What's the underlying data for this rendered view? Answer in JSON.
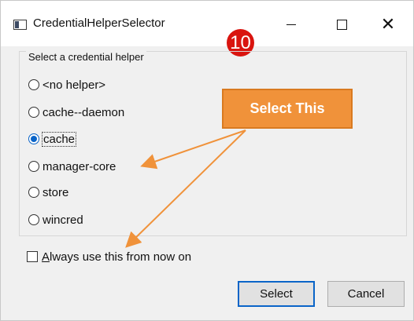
{
  "window": {
    "title": "CredentialHelperSelector",
    "controls": {
      "minimize": "minimize",
      "maximize": "maximize",
      "close": "✕"
    }
  },
  "annotation": {
    "step_number": "10",
    "callout_text": "Select This",
    "colors": {
      "callout": "#f0923a",
      "badge": "#d9140f"
    }
  },
  "group": {
    "legend": "Select a credential helper",
    "options": [
      {
        "label": "<no helper>",
        "selected": false
      },
      {
        "label": "cache--daemon",
        "selected": false
      },
      {
        "label": "cache",
        "selected": true
      },
      {
        "label": "manager-core",
        "selected": false
      },
      {
        "label": "store",
        "selected": false
      },
      {
        "label": "wincred",
        "selected": false
      }
    ]
  },
  "always_use": {
    "label": "Always use this from now on",
    "checked": false
  },
  "buttons": {
    "select": "Select",
    "cancel": "Cancel"
  },
  "colors": {
    "accent": "#0a64c8",
    "window_bg": "#f0f0f0"
  }
}
